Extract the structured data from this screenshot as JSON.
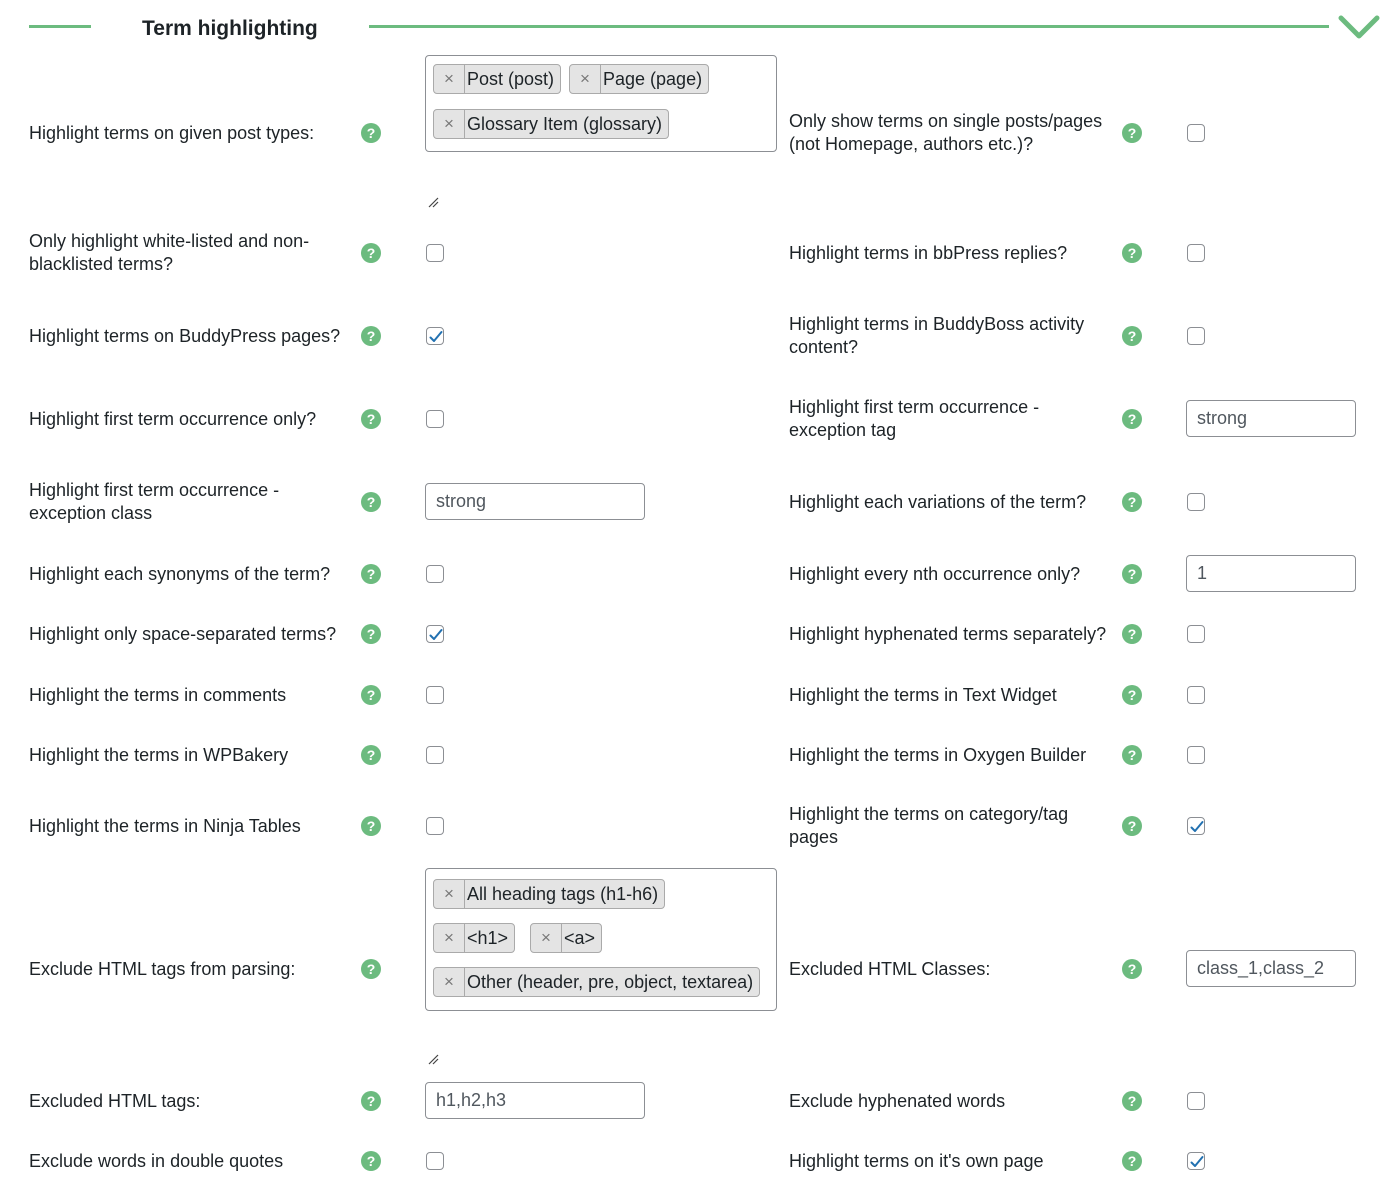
{
  "section": {
    "title": "Term highlighting"
  },
  "colors": {
    "accent": "#6cbb7f",
    "checkbox_check": "#2271b1"
  },
  "help_icon_text": "?",
  "chip_remove_glyph": "×",
  "post_types": [
    "Post (post)",
    "Page (page)",
    "Glossary Item (glossary)"
  ],
  "exclude_tags": [
    "All heading tags (h1-h6)",
    "<h1>",
    "<a>",
    "Other (header, pre, object, textarea)"
  ],
  "left": [
    {
      "label": "Highlight terms on given post types:"
    },
    {
      "label": "Only highlight white-listed and non-blacklisted terms?",
      "checked": false
    },
    {
      "label": "Highlight terms on BuddyPress pages?",
      "checked": true
    },
    {
      "label": "Highlight first term occurrence only?",
      "checked": false
    },
    {
      "label": "Highlight first term occurrence - exception class",
      "value": "strong"
    },
    {
      "label": "Highlight each synonyms of the term?",
      "checked": false
    },
    {
      "label": "Highlight only space-separated terms?",
      "checked": true
    },
    {
      "label": "Highlight the terms in comments",
      "checked": false
    },
    {
      "label": "Highlight the terms in WPBakery",
      "checked": false
    },
    {
      "label": "Highlight the terms in Ninja Tables",
      "checked": false
    },
    {
      "label": "Exclude HTML tags from parsing:"
    },
    {
      "label": "Excluded HTML tags:",
      "value": "h1,h2,h3"
    },
    {
      "label": "Exclude words in double quotes",
      "checked": false
    }
  ],
  "right": [
    {
      "label": "Only show terms on single posts/pages (not Homepage, authors etc.)?",
      "checked": false
    },
    {
      "label": "Highlight terms in bbPress replies?",
      "checked": false
    },
    {
      "label": "Highlight terms in BuddyBoss activity content?",
      "checked": false
    },
    {
      "label": "Highlight first term occurrence - exception tag",
      "value": "strong"
    },
    {
      "label": "Highlight each variations of the term?",
      "checked": false
    },
    {
      "label": "Highlight every nth occurrence only?",
      "value": "1"
    },
    {
      "label": "Highlight hyphenated terms separately?",
      "checked": false
    },
    {
      "label": "Highlight the terms in Text Widget",
      "checked": false
    },
    {
      "label": "Highlight the terms in Oxygen Builder",
      "checked": false
    },
    {
      "label": "Highlight the terms on category/tag pages",
      "checked": true
    },
    {
      "label": "Excluded HTML Classes:",
      "value": "class_1,class_2"
    },
    {
      "label": "Exclude hyphenated words",
      "checked": false
    },
    {
      "label": "Highlight terms on it's own page",
      "checked": true
    }
  ]
}
